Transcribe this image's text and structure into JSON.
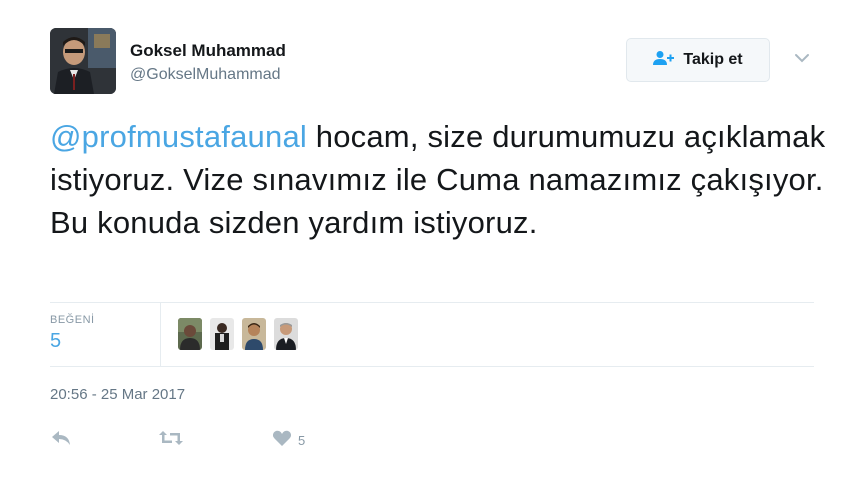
{
  "user": {
    "name": "Goksel Muhammad",
    "handle": "@GokselMuhammad"
  },
  "follow_button": {
    "label": "Takip et",
    "icon": "add-user-icon"
  },
  "menu_icon": "chevron-down-icon",
  "tweet": {
    "mention": "@profmustafaunal",
    "text": " hocam, size durumumuzu açıklamak istiyoruz. Vize sınavımız ile Cuma namazımız çakışıyor. Bu konuda sizden yardım istiyoruz."
  },
  "stats": {
    "likes_label": "BEĞENİ",
    "likes_count": "5"
  },
  "timestamp": "20:56 - 25 Mar 2017",
  "actions": {
    "reply_icon": "reply-icon",
    "retweet_icon": "retweet-icon",
    "like_icon": "heart-icon",
    "like_count": "5"
  },
  "colors": {
    "link": "#4aa6e3",
    "text": "#14171a",
    "secondary": "#657786",
    "icon": "#aab8c2"
  }
}
